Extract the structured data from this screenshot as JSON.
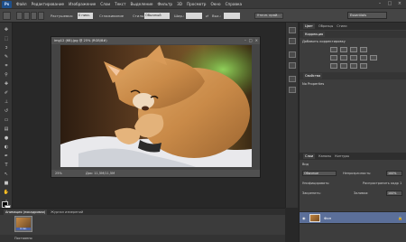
{
  "menubar": {
    "logo": "Ps",
    "items": [
      "Файл",
      "Редактирование",
      "Изображение",
      "Слои",
      "Текст",
      "Выделение",
      "Фильтр",
      "3D",
      "Просмотр",
      "Окно",
      "Справка"
    ],
    "controls": [
      "–",
      "□",
      "×"
    ]
  },
  "options": {
    "feather_label": "Растушевка:",
    "feather_value": "0 пикс.",
    "antialias_label": "Сглаживание",
    "style_label": "Стиль:",
    "style_value": "Обычный",
    "width_label": "Шир.:",
    "height_label": "Выс.:",
    "refine_button": "Уточн. край...",
    "workspace": "Essentials"
  },
  "document": {
    "title": "img12 (68).jpg @ 25% (RGB/8#)",
    "zoom": "25%",
    "doc_info": "Док: 11,5M/11,5M",
    "controls": [
      "–",
      "□",
      "×"
    ]
  },
  "panels": {
    "top_tabs": [
      "Цвет",
      "Образцы",
      "Стили"
    ],
    "adjustments_tab": "Коррекция",
    "adjustments_hint": "Добавить корректировку",
    "properties_tab": "Свойства",
    "properties_value": "No Properties",
    "layers_tabs": [
      "Слои",
      "Каналы",
      "Контуры"
    ],
    "kind_label": "Вид",
    "blend_mode": "Обычные",
    "opacity_label": "Непрозрачность:",
    "opacity_value": "100%",
    "lock_label": "Закрепить:",
    "fill_label": "Заливка:",
    "fill_value": "100%",
    "unify_label": "Унифицировать:",
    "propagate_label": "Распространить кадр 1",
    "layer_name": "Фон"
  },
  "bottom": {
    "tabs": [
      "Анимация (покадровая)",
      "Журнал измерений"
    ],
    "frame_time": "0 сек.",
    "loop": "Постоянно"
  }
}
